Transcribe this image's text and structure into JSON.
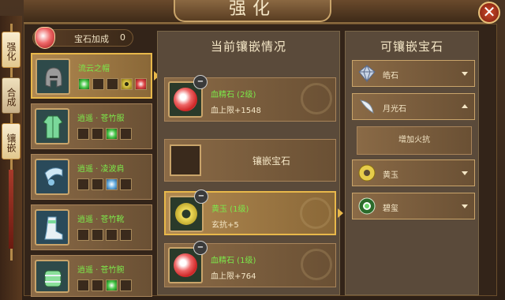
{
  "window": {
    "title": "强化",
    "close_label": "✕"
  },
  "side_tabs": [
    {
      "label": "强化",
      "active": true
    },
    {
      "label": "合成",
      "active": false
    },
    {
      "label": "镶嵌",
      "active": true
    }
  ],
  "bonus": {
    "label": "宝石加成",
    "value": "0"
  },
  "equipment": [
    {
      "name": "流云之帽",
      "selected": true,
      "slots": [
        "gem-green",
        "empty",
        "empty",
        "gem-jade",
        "gem-red"
      ]
    },
    {
      "name": "逍遥 · 苍竹服",
      "selected": false,
      "slots": [
        "empty",
        "empty",
        "gem-green",
        "empty"
      ]
    },
    {
      "name": "逍遥 · 凌波肩",
      "selected": false,
      "slots": [
        "empty",
        "empty",
        "gem-blue",
        "empty"
      ]
    },
    {
      "name": "逍遥 · 苍竹靴",
      "selected": false,
      "slots": [
        "empty",
        "empty",
        "empty",
        "empty"
      ]
    },
    {
      "name": "逍遥 · 苍竹腕",
      "selected": false,
      "slots": [
        "empty",
        "empty",
        "gem-green",
        "empty"
      ]
    }
  ],
  "current": {
    "title": "当前镶嵌情况",
    "remove_label": "−",
    "slot1": {
      "name": "血精石 (2级)",
      "stat_label": "血上限",
      "stat_value": "+1548"
    },
    "empty": {
      "label": "镶嵌宝石"
    },
    "slot3": {
      "name": "黄玉 (1级)",
      "stat_label": "玄抗",
      "stat_value": "+5"
    },
    "slot4": {
      "name": "血精石 (1级)",
      "stat_label": "血上限",
      "stat_value": "+764"
    }
  },
  "available": {
    "title": "可镶嵌宝石",
    "items": [
      {
        "label": "皓石",
        "expanded": false
      },
      {
        "label": "月光石",
        "expanded": true,
        "sub": "增加火抗"
      },
      {
        "label": "黄玉",
        "expanded": false
      },
      {
        "label": "碧玺",
        "expanded": false
      }
    ]
  },
  "colors": {
    "accent": "#e8b84a",
    "green_text": "#7ce84a",
    "cream_text": "#f4e6c6"
  }
}
